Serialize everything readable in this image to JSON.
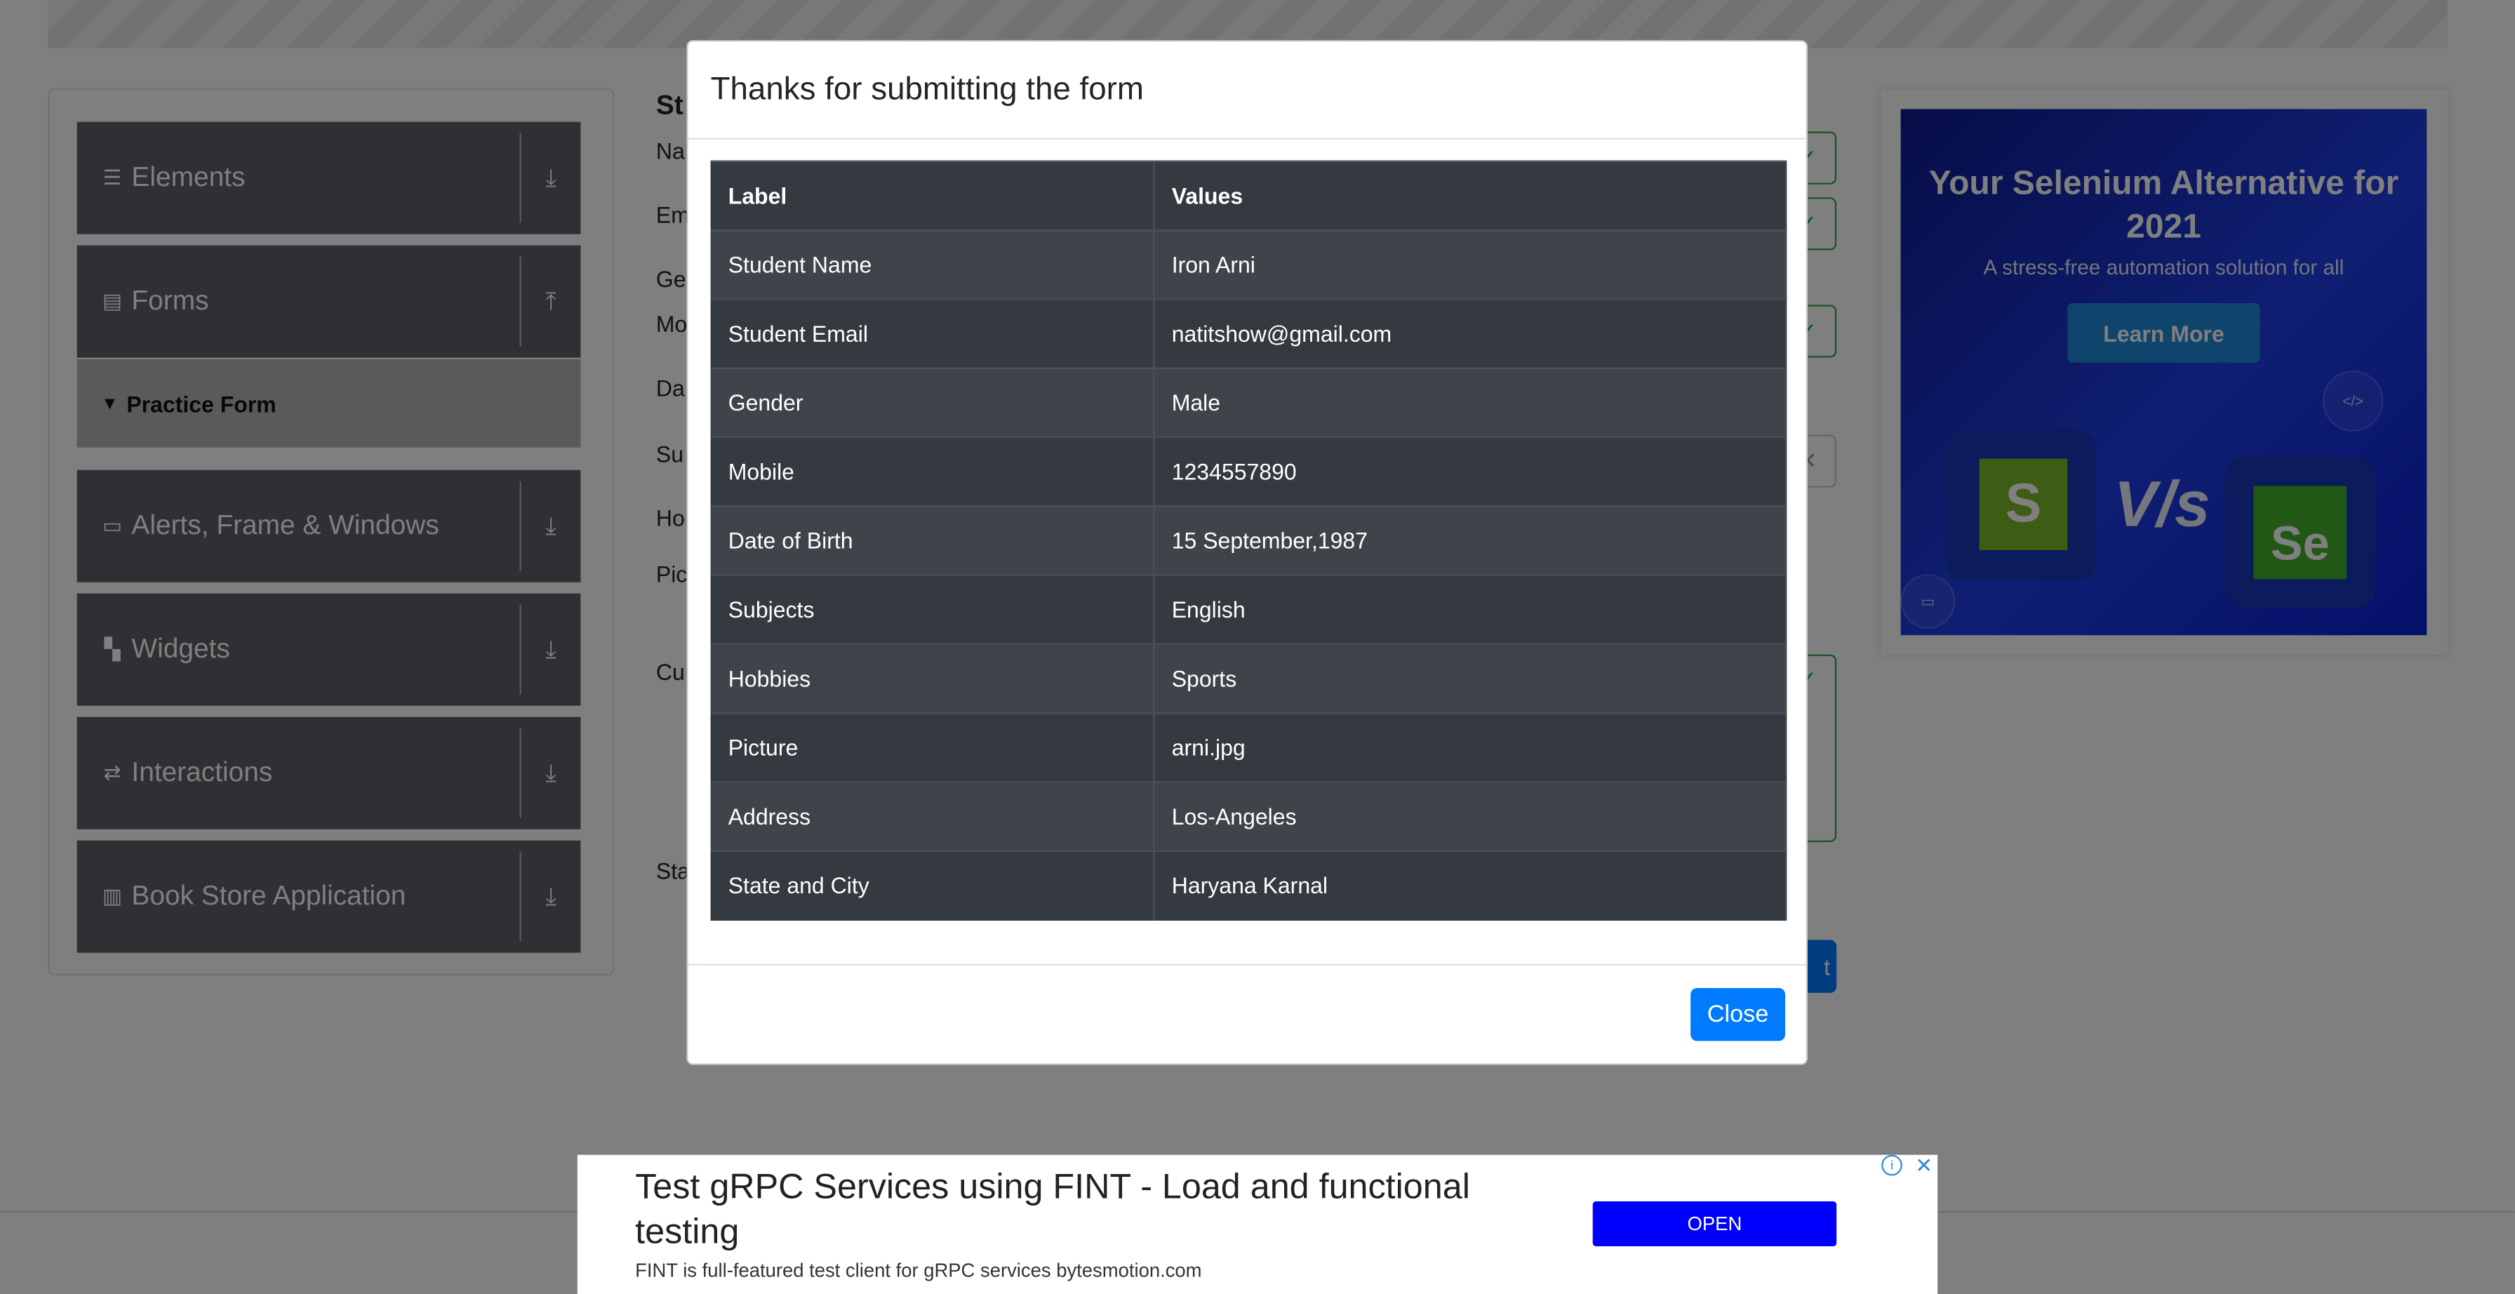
{
  "sidebar": {
    "groups": [
      {
        "label": "Elements",
        "icon": "hamburger-icon",
        "arrow": "download-icon"
      },
      {
        "label": "Forms",
        "icon": "document-icon",
        "arrow": "upload-icon"
      },
      {
        "label": "Alerts, Frame & Windows",
        "icon": "window-icon",
        "arrow": "download-icon"
      },
      {
        "label": "Widgets",
        "icon": "widgets-icon",
        "arrow": "download-icon"
      },
      {
        "label": "Interactions",
        "icon": "interactions-icon",
        "arrow": "download-icon"
      },
      {
        "label": "Book Store Application",
        "icon": "books-icon",
        "arrow": "download-icon"
      }
    ],
    "active_item": "Practice Form"
  },
  "form_partial": {
    "title": "St",
    "labels": [
      "Na",
      "Em",
      "Ge",
      "Mo",
      "Da",
      "Su",
      "Ho",
      "Pic",
      "Cu",
      "Sta"
    ],
    "submit_tail": "t"
  },
  "right_ad": {
    "headline": "Your Selenium Alternative for 2021",
    "subtitle": "A stress-free automation solution for all",
    "button": "Learn More",
    "vs": "V/s",
    "logo_left": "S",
    "logo_right": "Se"
  },
  "modal": {
    "title": "Thanks for submitting the form",
    "headers": [
      "Label",
      "Values"
    ],
    "rows": [
      [
        "Student Name",
        "Iron Arni"
      ],
      [
        "Student Email",
        "natitshow@gmail.com"
      ],
      [
        "Gender",
        "Male"
      ],
      [
        "Mobile",
        "1234557890"
      ],
      [
        "Date of Birth",
        "15 September,1987"
      ],
      [
        "Subjects",
        "English"
      ],
      [
        "Hobbies",
        "Sports"
      ],
      [
        "Picture",
        "arni.jpg"
      ],
      [
        "Address",
        "Los-Angeles"
      ],
      [
        "State and City",
        "Haryana Karnal"
      ]
    ],
    "close_label": "Close"
  },
  "bottom_ad": {
    "title": "Test gRPC Services using FINT - Load and functional testing",
    "description": "FINT is full-featured test client for gRPC services bytesmotion.com",
    "button": "OPEN",
    "info": "i",
    "close": "✕"
  },
  "colors": {
    "overlay": "#000000",
    "sidebar_group": "#5d6167",
    "table_dark": "#343a40",
    "primary": "#007bff",
    "ad_open": "#0000ff"
  }
}
